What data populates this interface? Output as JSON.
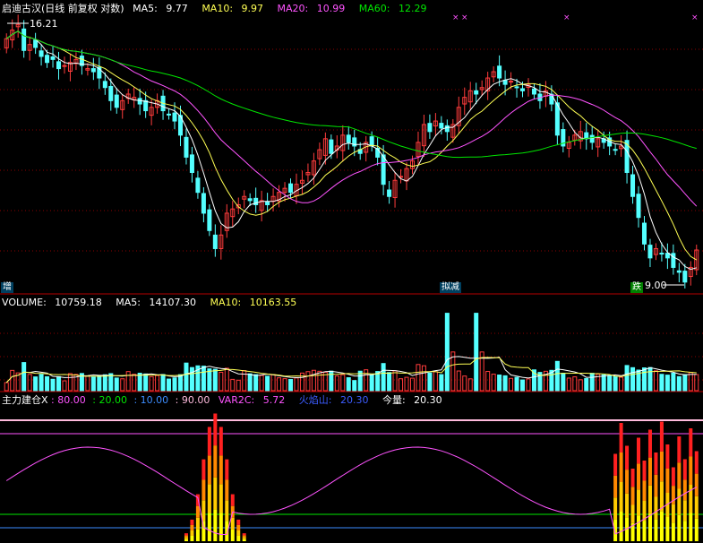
{
  "price_panel": {
    "stock_name": "启迪古汉",
    "mode": "(日线 前复权 对数)",
    "ma5_label": "MA5:",
    "ma5_value": "9.77",
    "ma10_label": "MA10:",
    "ma10_value": "9.97",
    "ma20_label": "MA20:",
    "ma20_value": "10.99",
    "ma60_label": "MA60:",
    "ma60_value": "12.29",
    "high_marker": "16.21",
    "low_marker": "9.00",
    "tag_left": "增",
    "tag_mid": "拟减",
    "tag_right": "跌"
  },
  "volume_panel": {
    "volume_label": "VOLUME:",
    "volume_value": "10759.18",
    "ma5_label": "MA5:",
    "ma5_value": "14107.30",
    "ma10_label": "MA10:",
    "ma10_value": "10163.55"
  },
  "indicator_panel": {
    "name": "主力建仓",
    "x_label": "X",
    "level_80": ": 80.00",
    "level_20": ": 20.00",
    "level_10": ": 10.00",
    "level_90": ": 90.00",
    "var2c_label": "VAR2C:",
    "var2c_value": "5.72",
    "flame_label": "火焰山:",
    "flame_value": "20.30",
    "today_label": "今量:",
    "today_value": "20.30"
  },
  "colors": {
    "up": "#ff3c3c",
    "down": "#54ffff",
    "ma5": "#ffffff",
    "ma10": "#ffff54",
    "ma20": "#ff54ff",
    "ma60": "#00e600",
    "grid": "#8b0000",
    "frame": "#b40000"
  },
  "chart_data": [
    {
      "type": "candlestick",
      "title": "启迪古汉(日线 前复权 对数)",
      "y_scale": "log",
      "ylim": [
        8.9,
        16.4
      ],
      "series": [
        {
          "name": "MA5",
          "last": 9.77
        },
        {
          "name": "MA10",
          "last": 9.97
        },
        {
          "name": "MA20",
          "last": 10.99
        },
        {
          "name": "MA60",
          "last": 12.29
        }
      ],
      "annotations": [
        {
          "text": "16.21",
          "kind": "high"
        },
        {
          "text": "9.00",
          "kind": "low"
        }
      ],
      "close": [
        15.6,
        15.9,
        16.1,
        15.2,
        15.4,
        15.3,
        15.0,
        14.8,
        14.9,
        14.6,
        14.7,
        14.8,
        14.9,
        14.7,
        14.6,
        14.5,
        14.3,
        14.0,
        13.6,
        13.4,
        13.6,
        13.8,
        13.7,
        13.5,
        13.3,
        13.4,
        13.6,
        13.3,
        13.2,
        13.0,
        12.6,
        12.0,
        11.6,
        11.1,
        10.6,
        10.2,
        9.8,
        10.1,
        10.6,
        10.7,
        10.8,
        11.0,
        10.9,
        10.8,
        10.9,
        10.8,
        11.0,
        11.1,
        11.2,
        11.1,
        11.3,
        11.4,
        11.6,
        11.9,
        12.2,
        12.5,
        12.1,
        12.3,
        12.6,
        12.4,
        12.3,
        12.1,
        12.4,
        12.3,
        12.0,
        11.3,
        11.0,
        11.4,
        11.5,
        11.7,
        11.9,
        12.4,
        12.9,
        12.7,
        13.0,
        12.8,
        12.7,
        12.9,
        13.4,
        13.7,
        13.9,
        13.8,
        14.0,
        14.3,
        14.5,
        14.3,
        14.1,
        14.2,
        14.0,
        13.9,
        14.1,
        13.8,
        13.6,
        13.9,
        13.5,
        12.6,
        12.3,
        12.4,
        12.6,
        12.7,
        12.5,
        12.4,
        12.5,
        12.4,
        12.3,
        12.2,
        12.3,
        11.6,
        11.0,
        10.5,
        9.9,
        9.6,
        9.8,
        9.7,
        9.6,
        9.4,
        9.3,
        9.1,
        9.4,
        9.77
      ],
      "volume_ma5_last": 14107.3,
      "volume_ma10_last": 10163.55,
      "volume_last": 10759.18
    },
    {
      "type": "bar",
      "title": "主力建仓",
      "levels": [
        80,
        20,
        10,
        90
      ],
      "var2c_last": 5.72,
      "flame_last": 20.3,
      "today_last": 20.3
    }
  ]
}
